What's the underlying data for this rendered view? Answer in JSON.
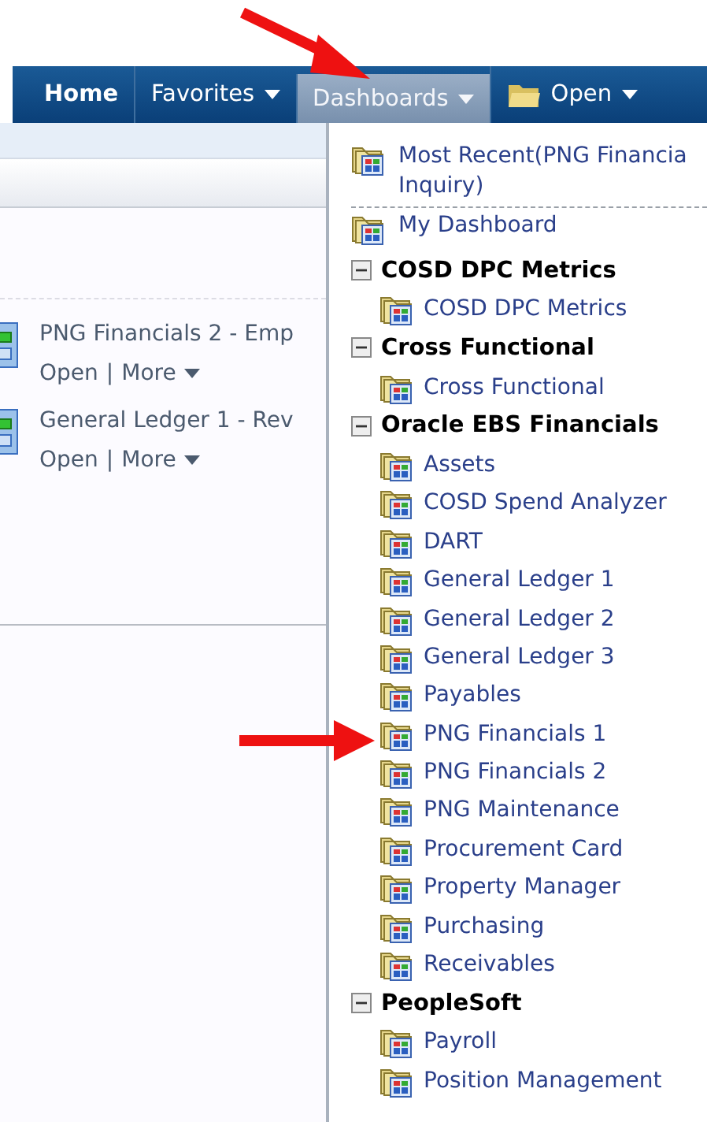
{
  "nav": {
    "tabs": [
      {
        "label": "Home",
        "selected": false,
        "kind": "plain"
      },
      {
        "label": "Favorites",
        "selected": false,
        "kind": "menu"
      },
      {
        "label": "Dashboards",
        "selected": true,
        "kind": "menu"
      },
      {
        "label": "Open",
        "selected": false,
        "kind": "folder-menu"
      }
    ]
  },
  "content": {
    "items": [
      {
        "title": "PNG Financials 2 - Emp",
        "actions": [
          "Open",
          "More"
        ],
        "separator": "|"
      },
      {
        "title": "General Ledger 1 - Rev",
        "actions": [
          "Open",
          "More"
        ],
        "separator": "|"
      }
    ]
  },
  "dashboards_menu": {
    "recent": [
      {
        "lines": [
          "Most Recent(PNG Financia",
          "Inquiry)"
        ]
      },
      {
        "lines": [
          "My Dashboard"
        ]
      }
    ],
    "groups": [
      {
        "name": "COSD DPC Metrics",
        "expanded": true,
        "items": [
          "COSD DPC Metrics"
        ]
      },
      {
        "name": "Cross Functional",
        "expanded": true,
        "items": [
          "Cross Functional"
        ]
      },
      {
        "name": "Oracle EBS Financials",
        "expanded": true,
        "items": [
          "Assets",
          "COSD Spend Analyzer",
          "DART",
          "General Ledger 1",
          "General Ledger 2",
          "General Ledger 3",
          "Payables",
          "PNG Financials 1",
          "PNG Financials 2",
          "PNG Maintenance",
          "Procurement Card",
          "Property Manager",
          "Purchasing",
          "Receivables"
        ]
      },
      {
        "name": "PeopleSoft",
        "expanded": true,
        "items": [
          "Payroll",
          "Position Management"
        ]
      }
    ]
  }
}
